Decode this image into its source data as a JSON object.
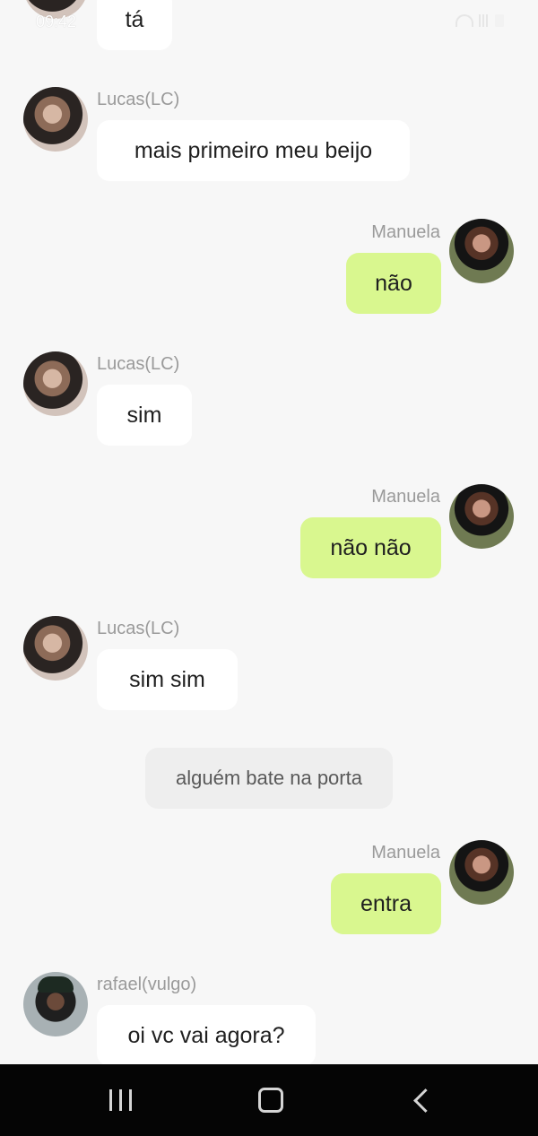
{
  "status_bar": {
    "time": "09:42"
  },
  "messages": [
    {
      "sender": "",
      "text": "tá",
      "side": "left",
      "avatar": "lucas"
    },
    {
      "sender": "Lucas(LC)",
      "text": "mais primeiro meu beijo",
      "side": "left",
      "avatar": "lucas"
    },
    {
      "sender": "Manuela",
      "text": "não",
      "side": "right",
      "avatar": "manuela"
    },
    {
      "sender": "Lucas(LC)",
      "text": "sim",
      "side": "left",
      "avatar": "lucas"
    },
    {
      "sender": "Manuela",
      "text": "não não",
      "side": "right",
      "avatar": "manuela"
    },
    {
      "sender": "Lucas(LC)",
      "text": "sim sim",
      "side": "left",
      "avatar": "lucas"
    },
    {
      "sender": "Manuela",
      "text": "entra",
      "side": "right",
      "avatar": "manuela"
    },
    {
      "sender": "rafael(vulgo)",
      "text": "oi vc vai agora?",
      "side": "left",
      "avatar": "rafael"
    }
  ],
  "narration": {
    "text": "alguém bate na porta"
  },
  "colors": {
    "background": "#f7f7f7",
    "incoming_bubble": "#ffffff",
    "outgoing_bubble": "#d9f78f",
    "narration_bubble": "#eeeeee",
    "nav_bar": "#050505"
  },
  "nav_bar": {
    "recent_icon": "recent-apps-icon",
    "home_icon": "home-icon",
    "back_icon": "back-icon"
  }
}
